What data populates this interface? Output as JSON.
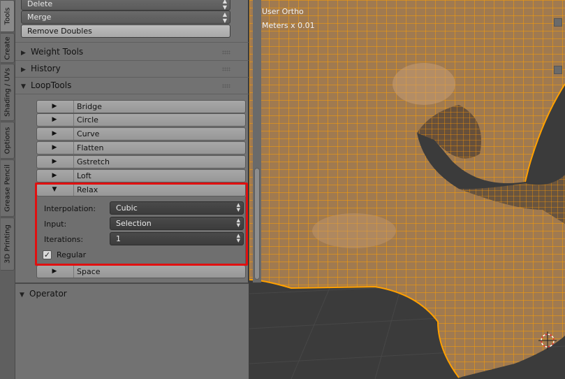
{
  "tabs": [
    "Tools",
    "Create",
    "Shading / UVs",
    "Options",
    "Grease Pencil",
    "3D Printing"
  ],
  "tools": {
    "delete_label": "Delete",
    "merge_label": "Merge",
    "remove_doubles_label": "Remove Doubles"
  },
  "panels": {
    "weight_tools": "Weight Tools",
    "history": "History",
    "looptools": "LoopTools",
    "operator": "Operator"
  },
  "looptools": {
    "items": [
      "Bridge",
      "Circle",
      "Curve",
      "Flatten",
      "Gstretch",
      "Loft",
      "Relax",
      "Space"
    ],
    "relax": {
      "interpolation_label": "Interpolation:",
      "interpolation_value": "Cubic",
      "input_label": "Input:",
      "input_value": "Selection",
      "iterations_label": "Iterations:",
      "iterations_value": "1",
      "regular_label": "Regular",
      "regular_checked": true
    }
  },
  "viewport": {
    "view_name": "User Ortho",
    "units": "Meters x 0.01"
  },
  "colors": {
    "mesh_wire": "#ffa000",
    "mesh_face": "#a07a50",
    "highlight": "#e01010"
  }
}
